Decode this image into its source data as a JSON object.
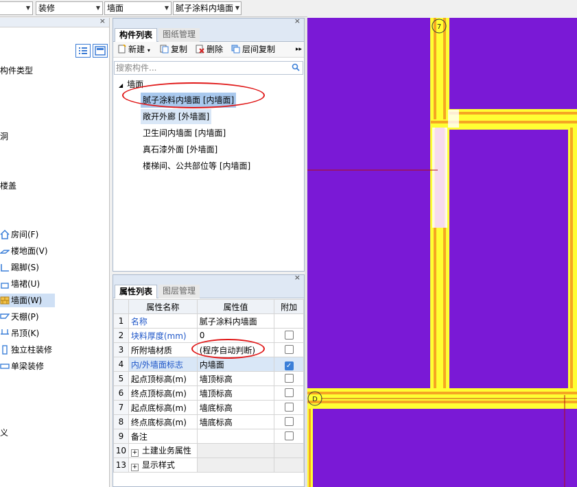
{
  "toolbar": {
    "combo_1": "",
    "combo_2": "装修",
    "combo_3": "墙面",
    "combo_4": "腻子涂料内墙面"
  },
  "left_panel": {
    "labels": [
      "构件类型",
      "洞",
      "楼盖",
      "义"
    ],
    "items": [
      {
        "label": "房间(F)",
        "icon": "room-icon"
      },
      {
        "label": "楼地面(V)",
        "icon": "floor-icon"
      },
      {
        "label": "踢脚(S)",
        "icon": "baseboard-icon"
      },
      {
        "label": "墙裙(U)",
        "icon": "dado-icon"
      },
      {
        "label": "墙面(W)",
        "icon": "wall-surface-icon",
        "selected": true
      },
      {
        "label": "天棚(P)",
        "icon": "ceiling-icon"
      },
      {
        "label": "吊顶(K)",
        "icon": "suspended-ceiling-icon"
      },
      {
        "label": "独立柱装修",
        "icon": "column-finish-icon"
      },
      {
        "label": "单梁装修",
        "icon": "beam-finish-icon"
      }
    ]
  },
  "component_panel": {
    "tabs": [
      "构件列表",
      "图纸管理"
    ],
    "actions": {
      "new": "新建",
      "copy": "复制",
      "delete": "删除",
      "floor_copy": "层间复制"
    },
    "search_placeholder": "搜索构件...",
    "tree_root": "墙面",
    "items": [
      "腻子涂料内墙面 [内墙面]",
      "敞开外廊 [外墙面]",
      "卫生间内墙面 [内墙面]",
      "真石漆外面 [外墙面]",
      "楼梯间、公共部位等 [内墙面]"
    ]
  },
  "property_panel": {
    "tabs": [
      "属性列表",
      "图层管理"
    ],
    "headers": {
      "name": "属性名称",
      "value": "属性值",
      "extra": "附加"
    },
    "rows": [
      {
        "num": "1",
        "name": "名称",
        "value": "腻子涂料内墙面",
        "blue": true,
        "checkbox": "none"
      },
      {
        "num": "2",
        "name": "块料厚度(mm)",
        "value": "0",
        "blue": true,
        "checkbox": "off"
      },
      {
        "num": "3",
        "name": "所附墙材质",
        "value": "(程序自动判断)",
        "blue": false,
        "checkbox": "off"
      },
      {
        "num": "4",
        "name": "内/外墙面标志",
        "value": "内墙面",
        "blue": true,
        "checkbox": "on"
      },
      {
        "num": "5",
        "name": "起点顶标高(m)",
        "value": "墙顶标高",
        "blue": false,
        "checkbox": "off"
      },
      {
        "num": "6",
        "name": "终点顶标高(m)",
        "value": "墙顶标高",
        "blue": false,
        "checkbox": "off"
      },
      {
        "num": "7",
        "name": "起点底标高(m)",
        "value": "墙底标高",
        "blue": false,
        "checkbox": "off"
      },
      {
        "num": "8",
        "name": "终点底标高(m)",
        "value": "墙底标高",
        "blue": false,
        "checkbox": "off"
      },
      {
        "num": "9",
        "name": "备注",
        "value": "",
        "blue": false,
        "checkbox": "off"
      },
      {
        "num": "10",
        "name": "土建业务属性",
        "value": "",
        "blue": false,
        "checkbox": "group"
      },
      {
        "num": "13",
        "name": "显示样式",
        "value": "",
        "blue": false,
        "checkbox": "group"
      }
    ]
  },
  "canvas": {
    "axis_labels": [
      "7",
      "D"
    ],
    "colors": {
      "background": "#7a19d6",
      "wall_outer": "#ffff33",
      "wall_inner": "#f5a623",
      "axis": "#b01010",
      "marker": "#e01818"
    }
  }
}
